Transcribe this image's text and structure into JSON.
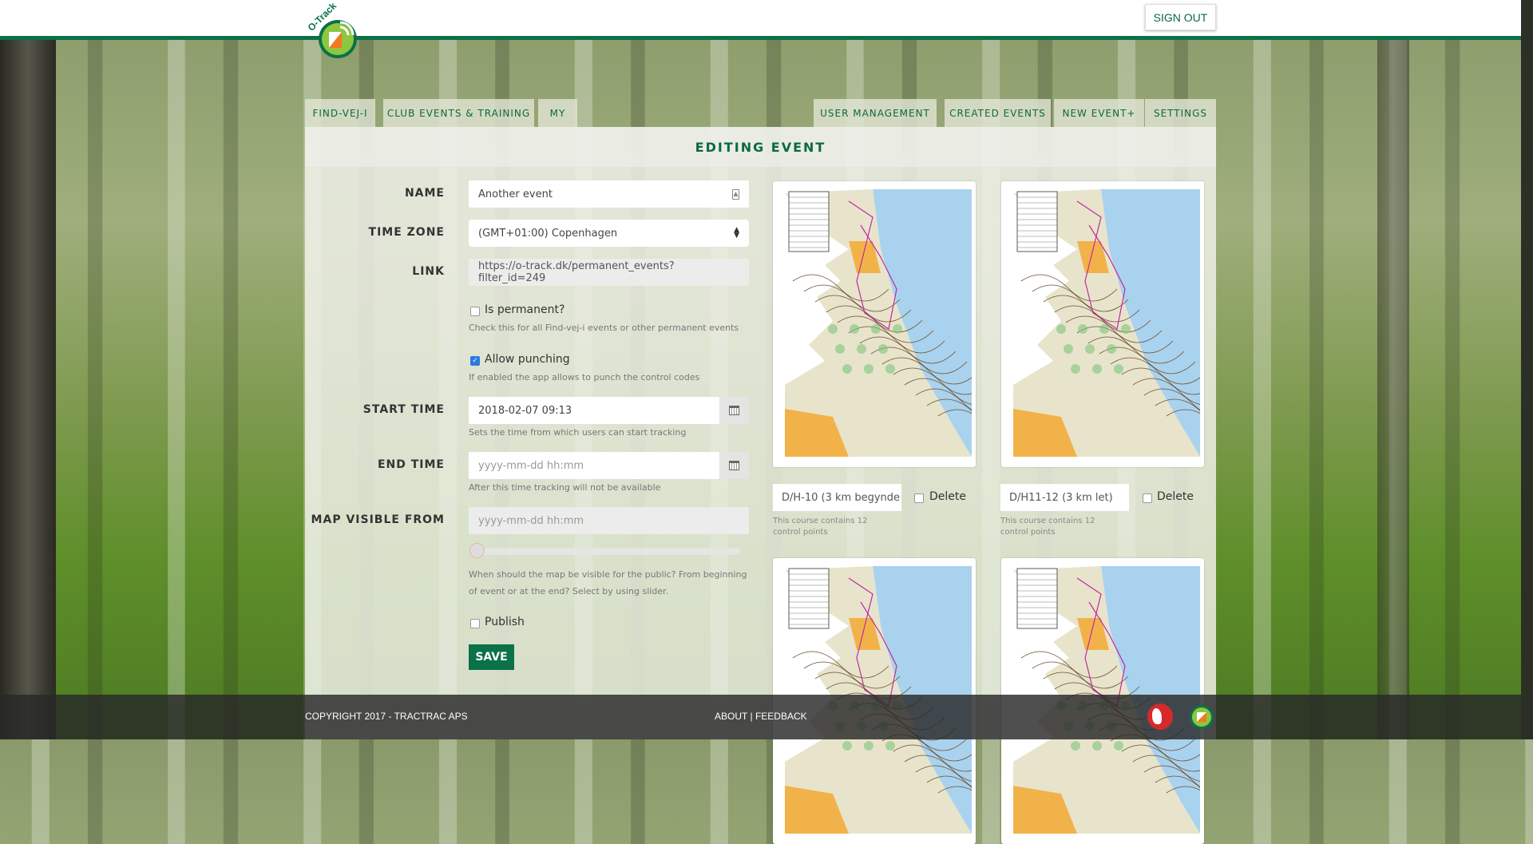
{
  "header": {
    "logo_text": "O-Track",
    "sign_out": "SIGN OUT"
  },
  "nav": {
    "left_tabs": [
      "FIND-VEJ-I",
      "CLUB EVENTS & TRAINING",
      "MY"
    ],
    "right_tabs": [
      "USER MANAGEMENT",
      "CREATED EVENTS",
      "NEW EVENT+",
      "SETTINGS"
    ]
  },
  "form": {
    "title": "EDITING EVENT",
    "name": {
      "label": "NAME",
      "value": "Another event"
    },
    "timezone": {
      "label": "TIME ZONE",
      "value": "(GMT+01:00) Copenhagen"
    },
    "link": {
      "label": "LINK",
      "value": "https://o-track.dk/permanent_events?filter_id=249"
    },
    "permanent": {
      "label": "Is permanent?",
      "checked": false,
      "help": "Check this for all Find-vej-i events or other permanent events"
    },
    "punching": {
      "label": "Allow punching",
      "checked": true,
      "help": "If enabled the app allows to punch the control codes"
    },
    "start": {
      "label": "START TIME",
      "value": "2018-02-07 09:13",
      "help": "Sets the time from which users can start tracking"
    },
    "end": {
      "label": "END TIME",
      "placeholder": "yyyy-mm-dd hh:mm",
      "help": "After this time tracking will not be available"
    },
    "map_visible": {
      "label": "MAP VISIBLE FROM",
      "placeholder": "yyyy-mm-dd hh:mm",
      "slider_value": 0,
      "help": "When should the map be visible for the public? From beginning of event or at the end? Select by using slider."
    },
    "publish": {
      "label": "Publish",
      "checked": false
    },
    "save": "SAVE"
  },
  "courses": [
    {
      "name": "D/H-10 (3 km begynde",
      "delete": "Delete",
      "help": "This course contains 12 control points"
    },
    {
      "name": "D/H11-12 (3 km let)",
      "delete": "Delete",
      "help": "This course contains 12 control points"
    }
  ],
  "footer": {
    "copyright": "COPYRIGHT 2017 - TRACTRAC APS",
    "about": "ABOUT",
    "sep": "|",
    "feedback": "FEEDBACK"
  },
  "colors": {
    "brand": "#0a7148",
    "accent_orange": "#f07a22",
    "logo_green": "#8dc63f"
  }
}
